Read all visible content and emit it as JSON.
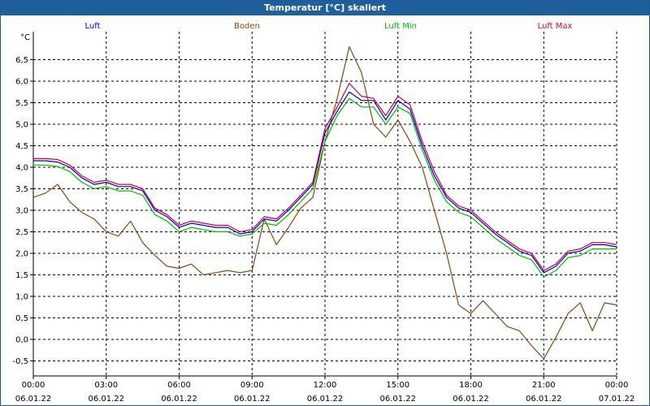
{
  "window": {
    "title": "Temperatur [°C] skaliert"
  },
  "chart_data": {
    "type": "line",
    "title": "Temperatur [°C] skaliert",
    "ylabel": "°C",
    "ylim": [
      -0.85,
      7.15
    ],
    "xlim_hours": [
      0,
      24
    ],
    "grid": true,
    "legend_placement": "top",
    "y_ticks": [
      "-0,5",
      "0,0",
      "0,5",
      "1,0",
      "1,5",
      "2,0",
      "2,5",
      "3,0",
      "3,5",
      "4,0",
      "4,5",
      "5,0",
      "5,5",
      "6,0",
      "6,5"
    ],
    "y_tick_values": [
      -0.5,
      0,
      0.5,
      1,
      1.5,
      2,
      2.5,
      3,
      3.5,
      4,
      4.5,
      5,
      5.5,
      6,
      6.5
    ],
    "x_ticks": [
      {
        "time": "00:00",
        "date": "06.01.22"
      },
      {
        "time": "03:00",
        "date": "06.01.22"
      },
      {
        "time": "06:00",
        "date": "06.01.22"
      },
      {
        "time": "09:00",
        "date": "06.01.22"
      },
      {
        "time": "12:00",
        "date": "06.01.22"
      },
      {
        "time": "15:00",
        "date": "06.01.22"
      },
      {
        "time": "18:00",
        "date": "06.01.22"
      },
      {
        "time": "21:00",
        "date": "06.01.22"
      },
      {
        "time": "00:00",
        "date": "07.01.22"
      }
    ],
    "x_tick_hours": [
      0,
      3,
      6,
      9,
      12,
      15,
      18,
      21,
      24
    ],
    "series": [
      {
        "name": "Luft",
        "color": "#0000cc",
        "x": [
          0,
          0.5,
          1,
          1.5,
          2,
          2.5,
          3,
          3.5,
          4,
          4.5,
          5,
          5.5,
          6,
          6.5,
          7,
          7.5,
          8,
          8.5,
          9,
          9.5,
          10,
          10.5,
          11,
          11.5,
          12,
          12.5,
          13,
          13.5,
          14,
          14.5,
          15,
          15.5,
          16,
          16.5,
          17,
          17.5,
          18,
          18.5,
          19,
          19.5,
          20,
          20.5,
          21,
          21.5,
          22,
          22.5,
          23,
          23.5,
          24
        ],
        "y": [
          4.15,
          4.15,
          4.12,
          4.0,
          3.75,
          3.6,
          3.65,
          3.55,
          3.55,
          3.45,
          3.0,
          2.85,
          2.6,
          2.7,
          2.65,
          2.6,
          2.6,
          2.45,
          2.5,
          2.8,
          2.75,
          3.0,
          3.3,
          3.6,
          4.8,
          5.3,
          5.75,
          5.55,
          5.55,
          5.1,
          5.55,
          5.35,
          4.5,
          3.8,
          3.3,
          3.05,
          2.95,
          2.7,
          2.45,
          2.25,
          2.05,
          1.95,
          1.55,
          1.7,
          2.0,
          2.05,
          2.2,
          2.2,
          2.15
        ]
      },
      {
        "name": "Boden",
        "color": "#8b4513",
        "x": [
          0,
          0.5,
          1,
          1.5,
          2,
          2.5,
          3,
          3.5,
          4,
          4.5,
          5,
          5.5,
          6,
          6.5,
          7,
          7.5,
          8,
          8.5,
          9,
          9.5,
          10,
          10.5,
          11,
          11.5,
          12,
          12.5,
          13,
          13.5,
          14,
          14.5,
          15,
          15.5,
          16,
          16.5,
          17,
          17.5,
          18,
          18.5,
          19,
          19.5,
          20,
          20.5,
          21,
          21.5,
          22,
          22.5,
          23,
          23.5,
          24
        ],
        "y": [
          3.3,
          3.4,
          3.6,
          3.2,
          2.95,
          2.8,
          2.5,
          2.4,
          2.75,
          2.25,
          1.95,
          1.7,
          1.65,
          1.75,
          1.5,
          1.55,
          1.6,
          1.55,
          1.6,
          2.8,
          2.2,
          2.6,
          3.05,
          3.3,
          4.6,
          5.6,
          6.8,
          6.2,
          5.0,
          4.7,
          5.1,
          4.6,
          4.0,
          3.0,
          2.0,
          0.8,
          0.6,
          0.9,
          0.6,
          0.3,
          0.2,
          -0.15,
          -0.45,
          0.05,
          0.6,
          0.85,
          0.2,
          0.85,
          0.8
        ]
      },
      {
        "name": "Luft Min",
        "color": "#00bb00",
        "x": [
          0,
          0.5,
          1,
          1.5,
          2,
          2.5,
          3,
          3.5,
          4,
          4.5,
          5,
          5.5,
          6,
          6.5,
          7,
          7.5,
          8,
          8.5,
          9,
          9.5,
          10,
          10.5,
          11,
          11.5,
          12,
          12.5,
          13,
          13.5,
          14,
          14.5,
          15,
          15.5,
          16,
          16.5,
          17,
          17.5,
          18,
          18.5,
          19,
          19.5,
          20,
          20.5,
          21,
          21.5,
          22,
          22.5,
          23,
          23.5,
          24
        ],
        "y": [
          4.05,
          4.05,
          4.02,
          3.9,
          3.65,
          3.5,
          3.55,
          3.45,
          3.45,
          3.35,
          2.9,
          2.75,
          2.5,
          2.6,
          2.55,
          2.5,
          2.5,
          2.4,
          2.45,
          2.7,
          2.65,
          2.9,
          3.2,
          3.5,
          4.6,
          5.2,
          5.6,
          5.4,
          5.4,
          5.0,
          5.4,
          5.25,
          4.4,
          3.7,
          3.2,
          2.95,
          2.85,
          2.6,
          2.35,
          2.15,
          1.95,
          1.85,
          1.45,
          1.6,
          1.9,
          1.95,
          2.1,
          2.1,
          2.1
        ]
      },
      {
        "name": "Luft Max",
        "color": "#cc0033",
        "x": [
          0,
          0.5,
          1,
          1.5,
          2,
          2.5,
          3,
          3.5,
          4,
          4.5,
          5,
          5.5,
          6,
          6.5,
          7,
          7.5,
          8,
          8.5,
          9,
          9.5,
          10,
          10.5,
          11,
          11.5,
          12,
          12.5,
          13,
          13.5,
          14,
          14.5,
          15,
          15.5,
          16,
          16.5,
          17,
          17.5,
          18,
          18.5,
          19,
          19.5,
          20,
          20.5,
          21,
          21.5,
          22,
          22.5,
          23,
          23.5,
          24
        ],
        "y": [
          4.2,
          4.2,
          4.18,
          4.05,
          3.8,
          3.65,
          3.7,
          3.6,
          3.6,
          3.5,
          3.05,
          2.9,
          2.65,
          2.75,
          2.7,
          2.65,
          2.65,
          2.5,
          2.55,
          2.85,
          2.8,
          3.05,
          3.35,
          3.65,
          4.9,
          5.4,
          5.95,
          5.65,
          5.6,
          5.2,
          5.65,
          5.45,
          4.6,
          3.9,
          3.35,
          3.1,
          3.0,
          2.75,
          2.5,
          2.3,
          2.1,
          2.0,
          1.6,
          1.75,
          2.05,
          2.1,
          2.25,
          2.25,
          2.2
        ]
      }
    ]
  }
}
